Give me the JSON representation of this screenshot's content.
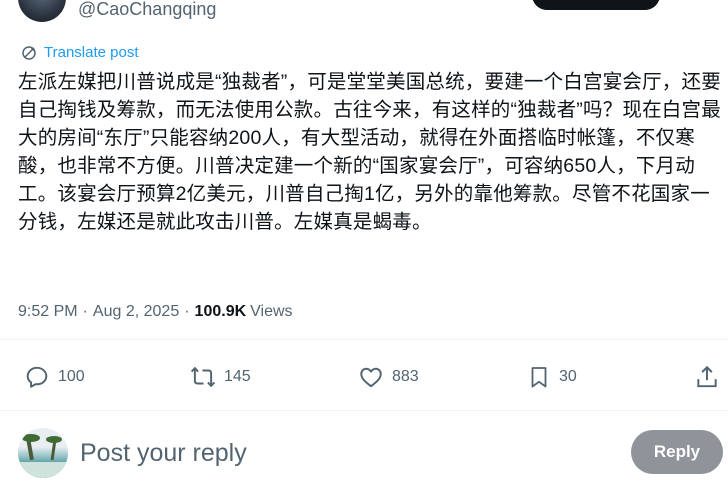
{
  "author": {
    "handle": "@CaoChangqing"
  },
  "translate": {
    "label": "Translate post"
  },
  "tweet": {
    "text": "左派左媒把川普说成是“独裁者”，可是堂堂美国总统，要建一个白宫宴会厅，还要自己掏钱及筹款，而无法使用公款。古往今来，有这样的“独裁者”吗？现在白宫最大的房间“东厅”只能容纳200人，有大型活动，就得在外面搭临时帐篷，不仅寒酸，也非常不方便。川普决定建一个新的“国家宴会厅”，可容纳650人，下月动工。该宴会厅预算2亿美元，川普自己掏1亿，另外的靠他筹款。尽管不花国家一分钱，左媒还是就此攻击川普。左媒真是蝎毒。",
    "time": "9:52 PM",
    "separator": "·",
    "date": "Aug 2, 2025",
    "views_count": "100.9K",
    "views_label": "Views"
  },
  "actions": {
    "replies": "100",
    "reposts": "145",
    "likes": "883",
    "bookmarks": "30"
  },
  "reply": {
    "placeholder": "Post your reply",
    "button_label": "Reply"
  },
  "colors": {
    "accent": "#1d9bf0",
    "muted": "#536471",
    "text": "#0f1419",
    "reply_button_bg": "#8e9499"
  }
}
